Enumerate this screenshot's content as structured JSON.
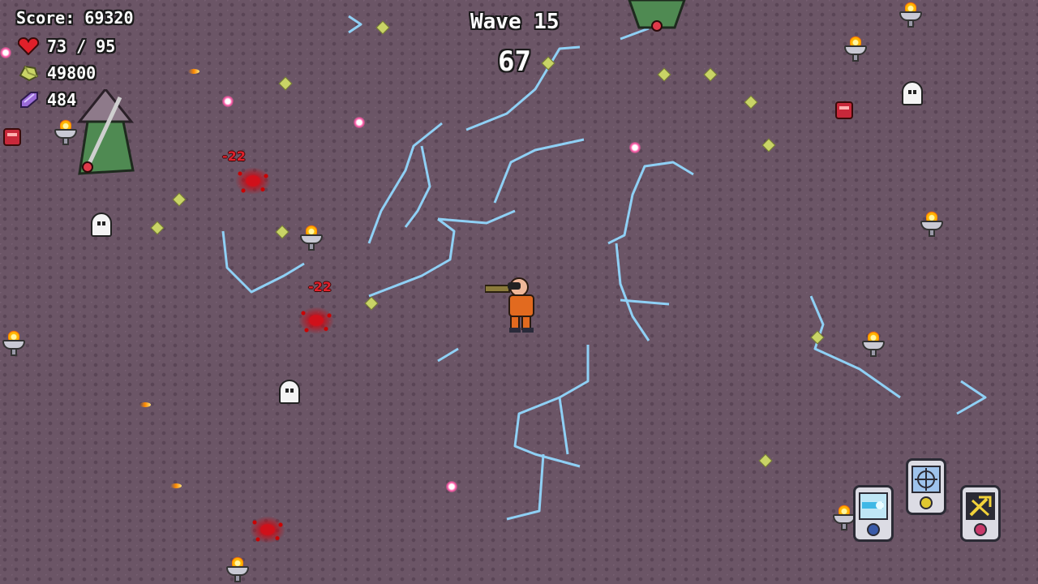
{
  "hud": {
    "score_label": "Score: 69320",
    "health": "73 / 95",
    "gold": "49800",
    "crystals": "484",
    "wave_label": "Wave 15",
    "timer": "67"
  },
  "damage_numbers": [
    "-22",
    "-22"
  ],
  "abilities": [
    {
      "icon": "frost-beam-icon"
    },
    {
      "icon": "crosshair-target-icon"
    },
    {
      "icon": "gold-pickaxe-icon"
    }
  ],
  "colors": {
    "background": "#6b5566",
    "lightning": "#8fd0f5",
    "health": "#e0202a",
    "gold_gem": "#c9d466",
    "crystal": "#9a6bd8"
  }
}
